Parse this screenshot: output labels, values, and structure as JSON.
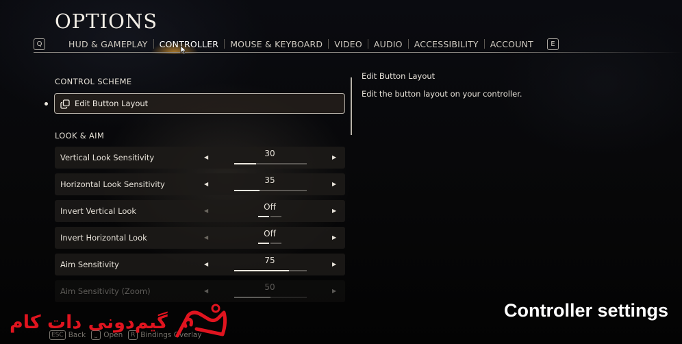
{
  "header": {
    "title": "OPTIONS",
    "prev_tab_key": "Q",
    "next_tab_key": "E",
    "tabs": [
      {
        "label": "HUD & GAMEPLAY",
        "active": false
      },
      {
        "label": "CONTROLLER",
        "active": true
      },
      {
        "label": "MOUSE & KEYBOARD",
        "active": false
      },
      {
        "label": "VIDEO",
        "active": false
      },
      {
        "label": "AUDIO",
        "active": false
      },
      {
        "label": "ACCESSIBILITY",
        "active": false
      },
      {
        "label": "ACCOUNT",
        "active": false
      }
    ]
  },
  "sections": {
    "control_scheme": {
      "header": "CONTROL SCHEME",
      "edit_button_label": "Edit Button Layout",
      "edit_button_icon": "copy-layout-icon"
    },
    "look_aim": {
      "header": "LOOK & AIM",
      "settings": [
        {
          "label": "Vertical Look Sensitivity",
          "type": "slider",
          "value": "30",
          "fill_percent": 30
        },
        {
          "label": "Horizontal Look Sensitivity",
          "type": "slider",
          "value": "35",
          "fill_percent": 35
        },
        {
          "label": "Invert Vertical Look",
          "type": "toggle",
          "value": "Off",
          "option_index": 0,
          "option_count": 2
        },
        {
          "label": "Invert Horizontal Look",
          "type": "toggle",
          "value": "Off",
          "option_index": 0,
          "option_count": 2
        },
        {
          "label": "Aim Sensitivity",
          "type": "slider",
          "value": "75",
          "fill_percent": 75
        },
        {
          "label": "Aim Sensitivity (Zoom)",
          "type": "slider",
          "value": "50",
          "fill_percent": 50
        }
      ]
    }
  },
  "description": {
    "title": "Edit Button Layout",
    "text": "Edit the button layout on your controller."
  },
  "footer": {
    "hints": [
      {
        "key": "ESC",
        "label": "Back"
      },
      {
        "key": "⎵",
        "label": "Open"
      },
      {
        "key": "R",
        "label": "Bindings Overlay"
      }
    ]
  },
  "overlay": {
    "watermark_text": "گیم‌دونی دات کام",
    "caption": "Controller settings",
    "watermark_color": "#e0141f"
  }
}
